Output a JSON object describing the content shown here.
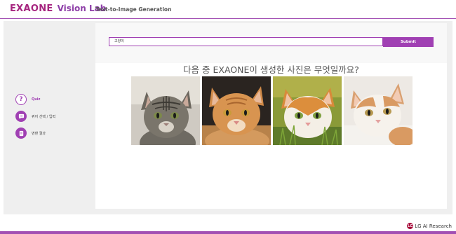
{
  "header": {
    "logo_exaone": "EXAONE",
    "logo_vision": "Vision Lab",
    "subtitle": "Text-to-Image Generation"
  },
  "sidebar": {
    "items": [
      {
        "icon": "question-icon",
        "glyph": "?",
        "label": "Quiz",
        "active": true
      },
      {
        "icon": "chat-icon",
        "label": "퀴어 선택 / 입력",
        "active": false
      },
      {
        "icon": "result-icon",
        "label": "변환 결과",
        "active": false
      }
    ]
  },
  "main": {
    "search": {
      "value": "고양이"
    },
    "submit_label": "Submit",
    "question": "다음 중 EXAONE이 생성한 사진은 무엇일까요?"
  },
  "footer": {
    "brand_mark": "LG",
    "brand_text": "LG AI Research"
  },
  "colors": {
    "accent": "#a040b3",
    "brand": "#a6257f"
  }
}
